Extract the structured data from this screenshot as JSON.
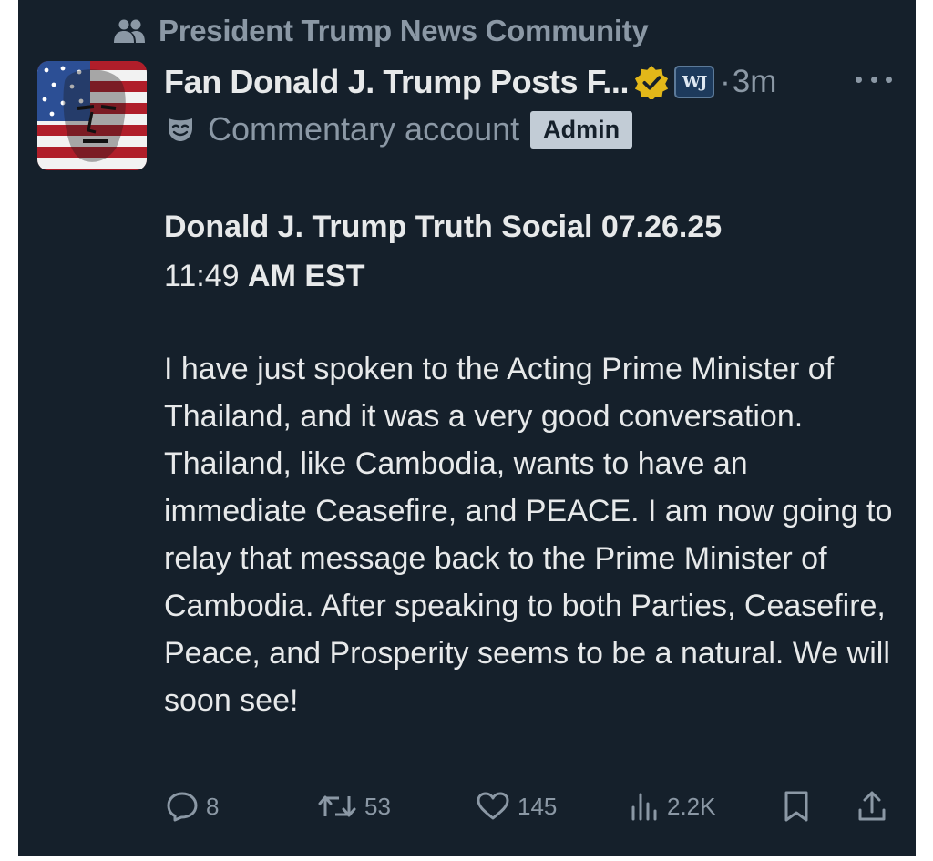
{
  "community": {
    "name": "President Trump News Community",
    "icon": "community-icon"
  },
  "author": {
    "display_name": "Fan Donald J. Trump Posts F...",
    "verified_badge": "gold-verified-icon",
    "affiliate_badge_text": "WJ",
    "separator": "·",
    "time_ago": "3m",
    "account_label": "Commentary account",
    "account_label_icon": "mask-icon",
    "role_badge": "Admin"
  },
  "post": {
    "title_bold": "Donald J. Trump Truth Social 07.26.25",
    "time_normal": "11:49",
    "time_bold": "AM EST",
    "body": "I have just spoken to the Acting Prime Minister of Thailand, and it was a very good conversation. Thailand, like Cambodia, wants to have an immediate Ceasefire, and PEACE. I am now going to relay that message back to the Prime Minister of Cambodia. After speaking to both Parties, Ceasefire, Peace, and Prosperity seems to be a natural. We will soon see!"
  },
  "actions": {
    "replies": "8",
    "reposts": "53",
    "likes": "145",
    "views": "2.2K"
  },
  "colors": {
    "background": "#15202b",
    "primary_text": "#e7e9ea",
    "secondary_text": "#8b98a5",
    "verified_gold": "#e2b719",
    "admin_badge": "#c2ccd6"
  }
}
